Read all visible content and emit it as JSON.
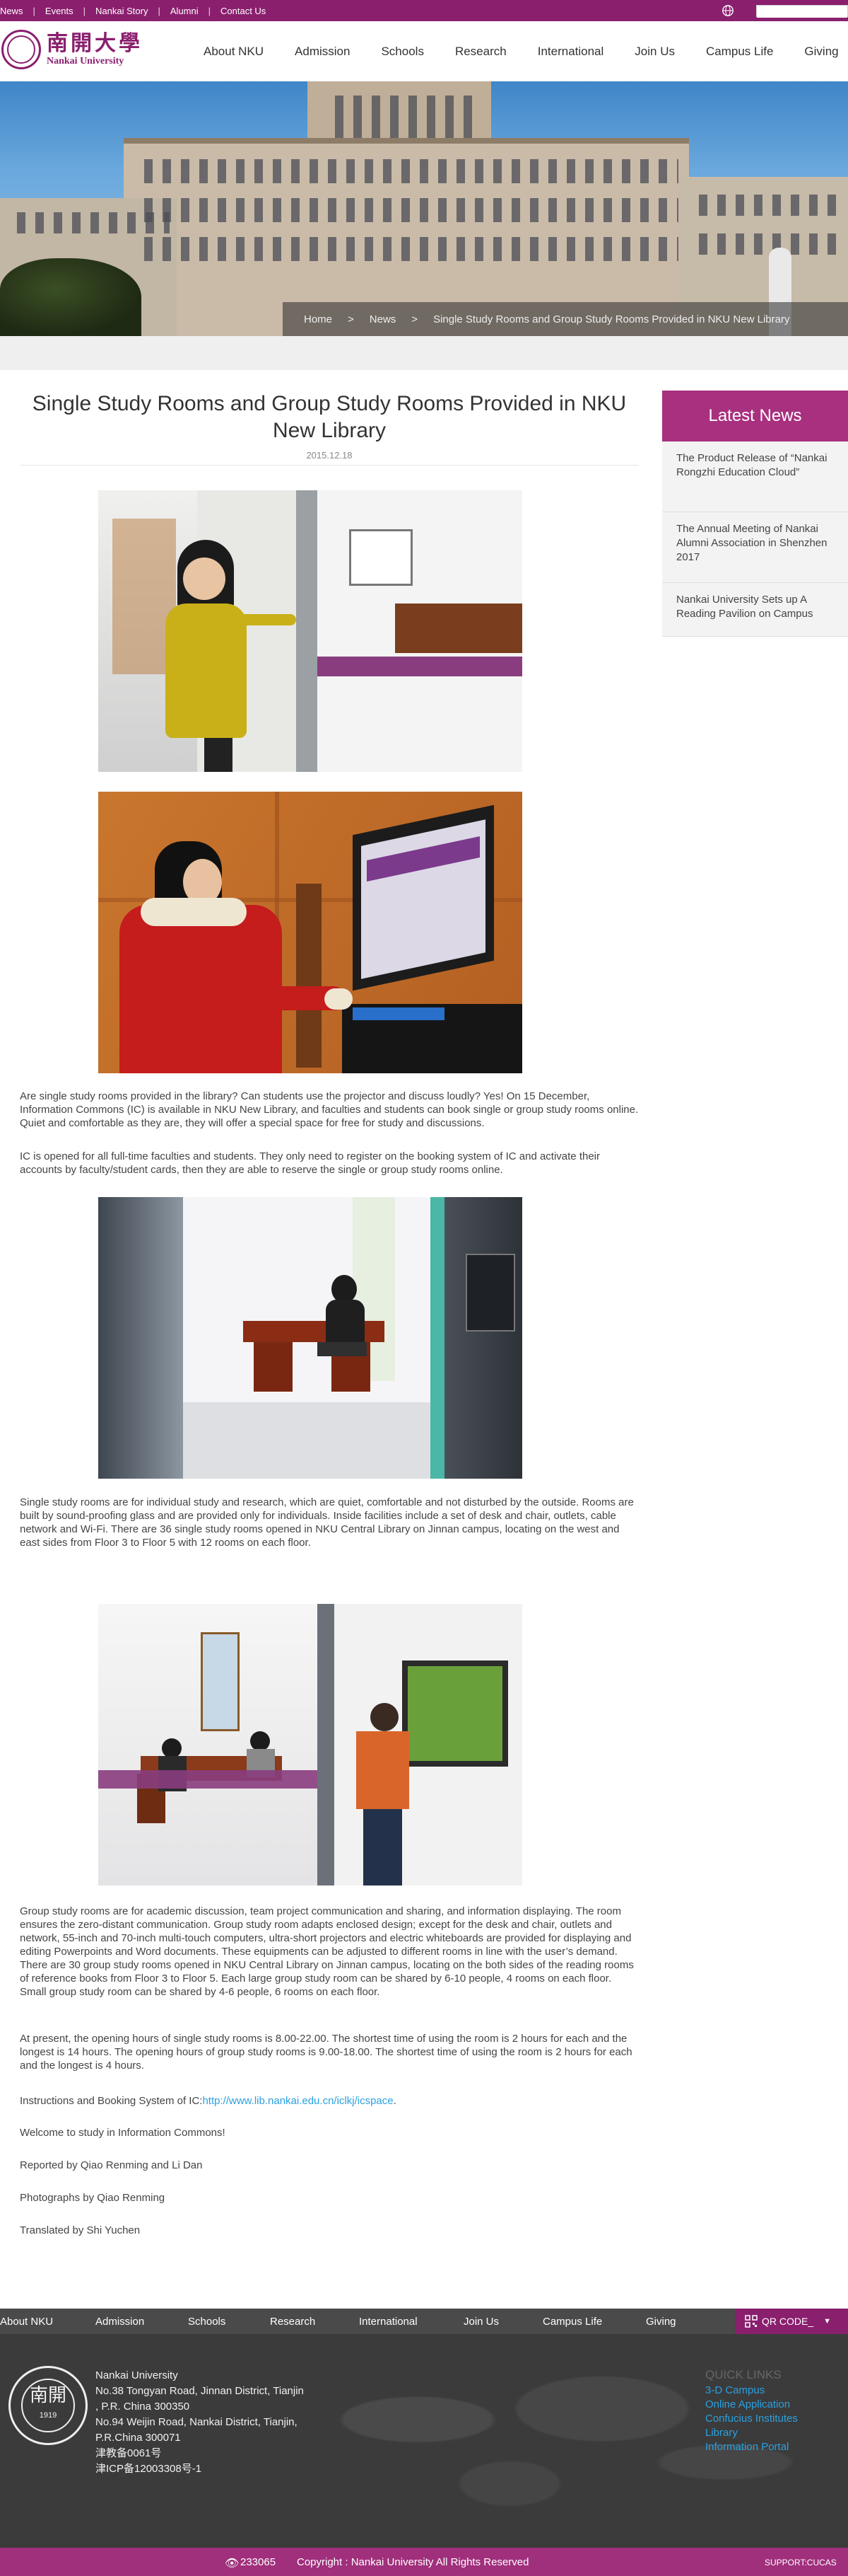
{
  "topbar": {
    "links": [
      "News",
      "Events",
      "Nankai Story",
      "Alumni",
      "Contact Us"
    ],
    "search_placeholder": ""
  },
  "logo": {
    "cn": "南開大學",
    "en": "Nankai University"
  },
  "mainnav": [
    "About NKU",
    "Admission",
    "Schools",
    "Research",
    "International",
    "Join Us",
    "Campus Life",
    "Giving"
  ],
  "breadcrumb": [
    "Home",
    ">",
    "News",
    ">",
    "Single Study Rooms and Group Study Rooms Provided in NKU New Library"
  ],
  "article": {
    "title": "Single Study Rooms and Group Study Rooms Provided in NKU New Library",
    "date": "2015.12.18",
    "p1": "Are single study rooms provided in the library? Can students use the projector and discuss loudly? Yes! On 15 December, Information Commons (IC) is available in NKU New Library, and faculties and students can book single or group study rooms online. Quiet and comfortable as they are, they will offer a special space for free for study and discussions.",
    "p2": "IC is opened for all full-time faculties and students. They only need to register on the booking system of IC and activate their accounts by faculty/student cards, then they are able to reserve the single or group study rooms online.",
    "p3": "Single study rooms are for individual study and research, which are quiet, comfortable and not disturbed by the outside. Rooms are built by sound-proofing glass and are provided only for individuals. Inside facilities include a set of desk and chair, outlets, cable network and Wi-Fi. There are 36 single study rooms opened in NKU Central Library on Jinnan campus, locating on the west and east sides from Floor 3 to Floor 5 with 12 rooms on each floor.",
    "p4": "Group study rooms are for academic discussion, team project communication and sharing, and information displaying. The room ensures the zero-distant communication. Group study room adapts enclosed design; except for the desk and chair, outlets and network, 55-inch and 70-inch multi-touch computers, ultra-short projectors and electric whiteboards are provided for displaying and editing Powerpoints and Word documents. These equipments can be adjusted to different rooms in line with the user’s demand. There are 30 group study rooms opened in NKU Central Library on Jinnan campus, locating on the both sides of the reading rooms of reference books from Floor 3 to Floor 5. Each large group study room can be shared by 6-10 people, 4 rooms on each floor. Small group study room can be shared by 4-6 people, 6 rooms on each floor.",
    "p5": "At present, the opening hours of single study rooms is 8.00-22.00. The shortest time of using the room is 2 hours for each and the longest is 14 hours. The opening hours of group study rooms is 9.00-18.00. The shortest time of using the room is 2 hours for each and the longest is 4 hours.",
    "p6_label": "Instructions and Booking System of IC:",
    "p6_link": "http://www.lib.nankai.edu.cn/iclkj/icspace",
    "p6_end": ".",
    "p7": "Welcome to study in Information Commons!",
    "p8": "Reported by Qiao Renming and Li Dan",
    "p9": "Photographs by Qiao Renming",
    "p10": "Translated by Shi Yuchen"
  },
  "sidebar": {
    "title": "Latest News",
    "items": [
      "The Product Release of “Nankai Rongzhi Education Cloud”",
      "The Annual Meeting of Nankai Alumni Association in Shenzhen 2017",
      "Nankai University Sets up A Reading Pavilion on Campus"
    ]
  },
  "footnav": {
    "items": [
      "About NKU",
      "Admission",
      "Schools",
      "Research",
      "International",
      "Join Us",
      "Campus Life",
      "Giving"
    ],
    "qr": "QR CODE_"
  },
  "footer": {
    "seal_text": "南開",
    "seal_year": "1919",
    "address": [
      "Nankai University",
      "No.38 Tongyan Road, Jinnan District, Tianjin",
      ", P.R. China 300350",
      "No.94 Weijin Road,  Nankai District, Tianjin,",
      "P.R.China  300071",
      "津教备0061号",
      "津ICP备12003308号-1"
    ],
    "quick_title": "QUICK LINKS",
    "quick_links": [
      "3-D Campus",
      "Online Application",
      "Confucius Institutes",
      "Library",
      "Information Portal"
    ]
  },
  "copyright": {
    "count": "233065",
    "text": "Copyright : Nankai University All Rights Reserved",
    "support": "SUPPORT:CUCAS"
  },
  "colors": {
    "brand": "#8a1f6e",
    "sidebar_head": "#a8307f",
    "link": "#2aa0e0"
  }
}
